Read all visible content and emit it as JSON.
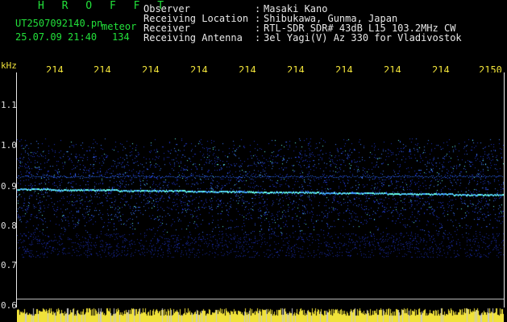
{
  "header": {
    "brand": "H R O F F T",
    "file_name": "UT2507092140.pn",
    "file_suffix": "meteor",
    "date_time": "25.07.09 21:40",
    "count": "134"
  },
  "meta": [
    {
      "label": "Observer",
      "value": "Masaki Kano"
    },
    {
      "label": "Receiving Location",
      "value": "Shibukawa, Gunma, Japan"
    },
    {
      "label": "Receiver",
      "value": "RTL-SDR SDR# 43dB L15 103.2MHz CW"
    },
    {
      "label": "Receiving Antenna",
      "value": "3el Yagi(V) Az 330 for Vladivostok"
    }
  ],
  "axis": {
    "y_unit": "kHz",
    "x_ticks": [
      "214",
      "214",
      "214",
      "214",
      "214",
      "214",
      "214",
      "214",
      "214",
      "2150"
    ],
    "y_ticks": [
      "1.1",
      "1.0",
      "0.9",
      "0.8",
      "0.7",
      "0.6"
    ]
  },
  "colors": {
    "background": "#000000",
    "header_green": "#22e03a",
    "label_yellow": "#f0e23a",
    "signal_blue": "#2a52ff",
    "signal_cyan": "#66ffee",
    "bar_yellow": "#f0e23a"
  }
}
